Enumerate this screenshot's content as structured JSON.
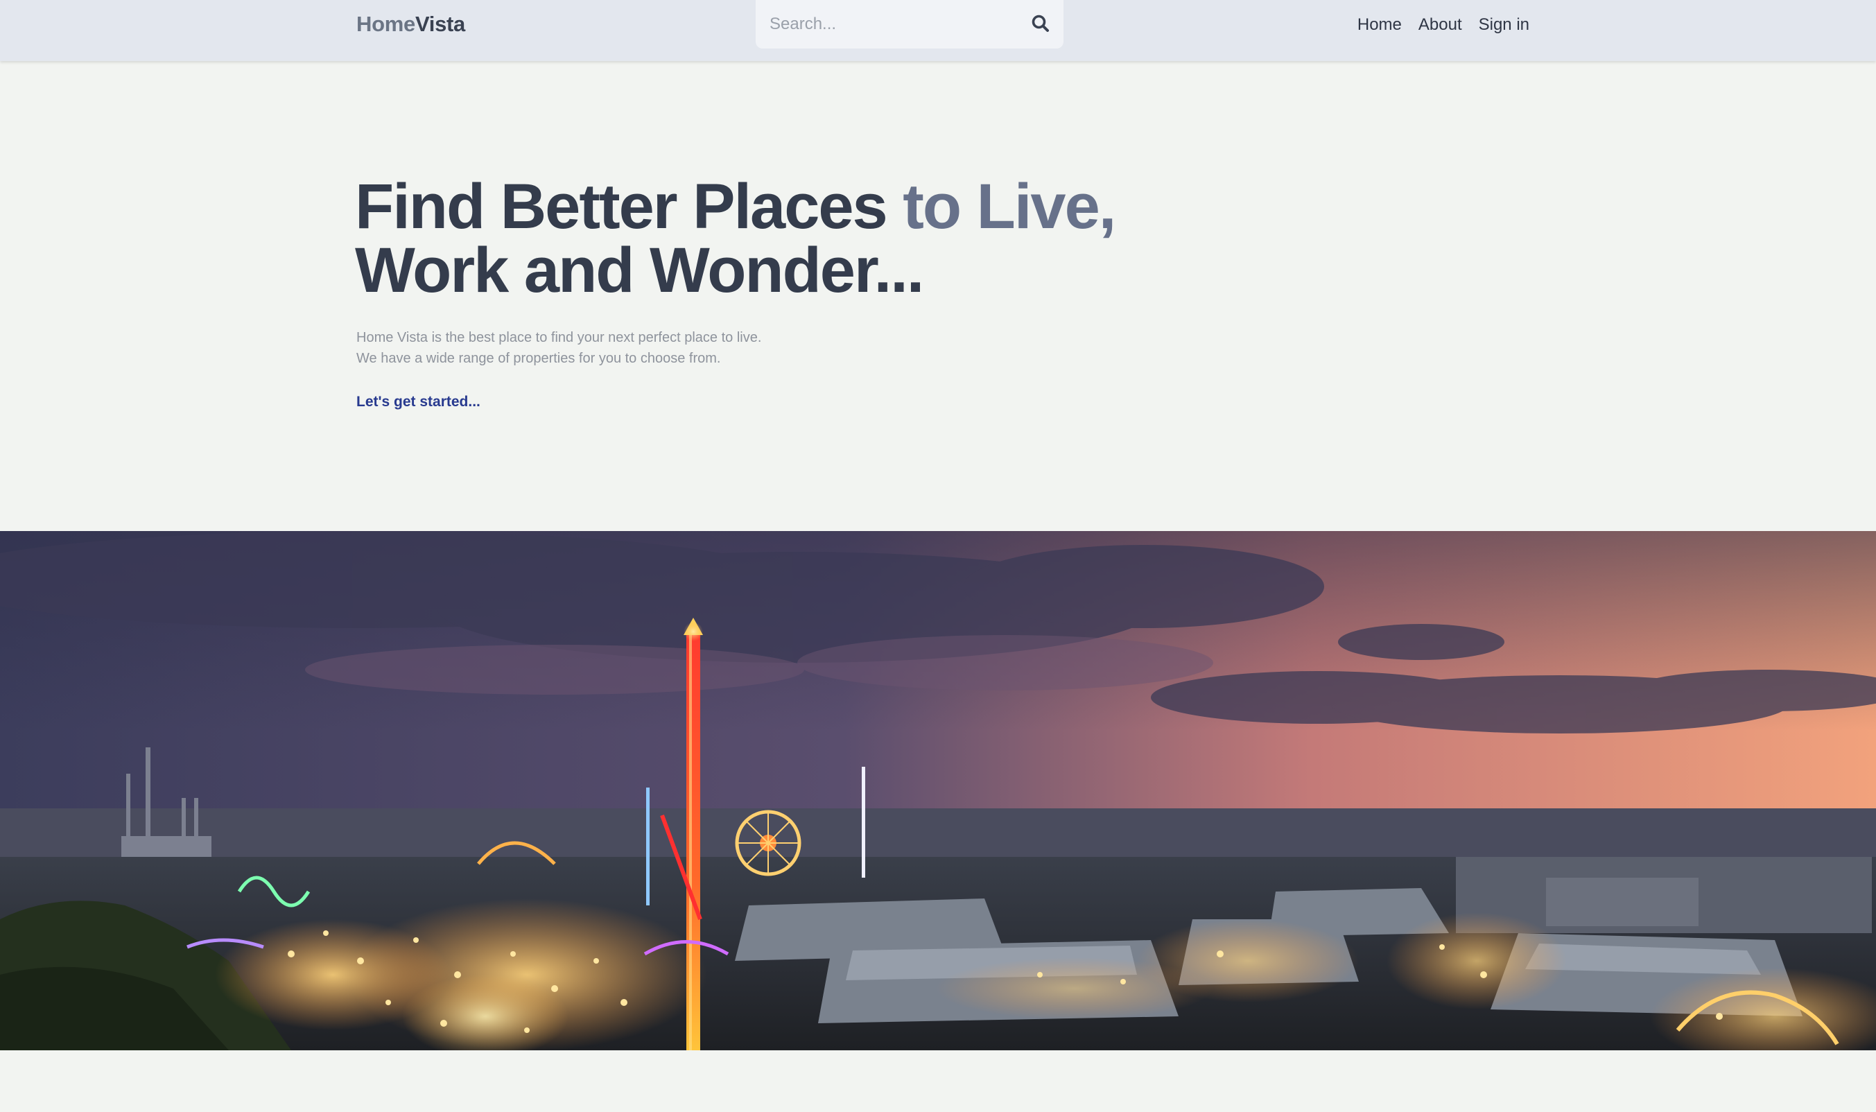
{
  "brand": {
    "part1": "Home",
    "part2": "Vista"
  },
  "search": {
    "placeholder": "Search...",
    "icon": "search-icon"
  },
  "nav": {
    "home": "Home",
    "about": "About",
    "signin": "Sign in"
  },
  "hero": {
    "title_part1": "Find Better Places ",
    "title_part2": "to Live,",
    "title_line2": "Work and Wonder...",
    "subtitle_line1": "Home Vista is the best place to find your next perfect place to live.",
    "subtitle_line2": "We have a wide range of properties for you to choose from.",
    "cta": "Let's get started..."
  },
  "colors": {
    "page_bg": "#f2f4f1",
    "navbar_bg": "#e3e7ee",
    "heading": "#343c4c",
    "heading_muted": "#67718a",
    "cta": "#283a8f",
    "sky_dusk": "#f0a47f",
    "sky_night": "#3d3f5f"
  }
}
